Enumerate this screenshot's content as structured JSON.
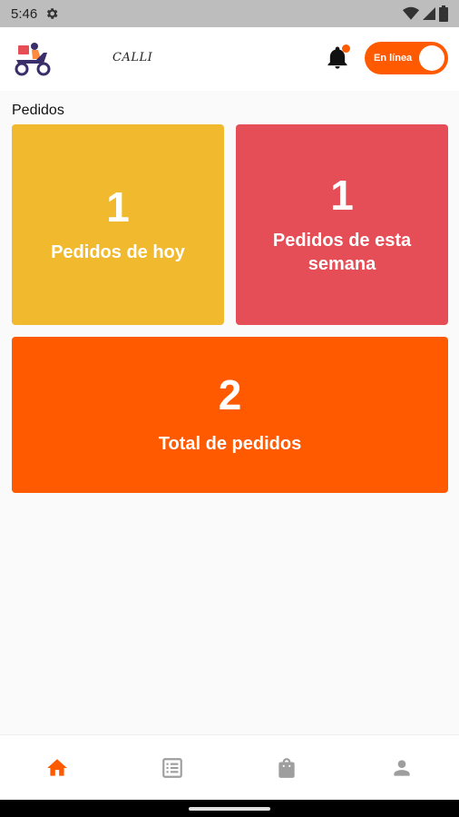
{
  "status_bar": {
    "time": "5:46",
    "icons": [
      "gear-icon",
      "wifi-icon",
      "signal-icon",
      "battery-icon"
    ]
  },
  "app_bar": {
    "logo_text": "CALLI",
    "logo_icon": "scooter-delivery-icon",
    "notification_icon": "bell-icon",
    "online_toggle": {
      "label": "En línea",
      "on": true
    }
  },
  "section": {
    "title": "Pedidos"
  },
  "cards": {
    "today": {
      "value": "1",
      "label": "Pedidos de hoy",
      "color": "#f0b92e"
    },
    "week": {
      "value": "1",
      "label": "Pedidos de esta semana",
      "color": "#e54e56"
    },
    "total": {
      "value": "2",
      "label": "Total de pedidos",
      "color": "#ff5a00"
    }
  },
  "bottom_nav": {
    "items": [
      {
        "icon": "home-icon",
        "active": true
      },
      {
        "icon": "list-icon",
        "active": false
      },
      {
        "icon": "shopping-bag-icon",
        "active": false
      },
      {
        "icon": "person-icon",
        "active": false
      }
    ],
    "active_color": "#ff5a00",
    "inactive_color": "#9e9e9e"
  }
}
